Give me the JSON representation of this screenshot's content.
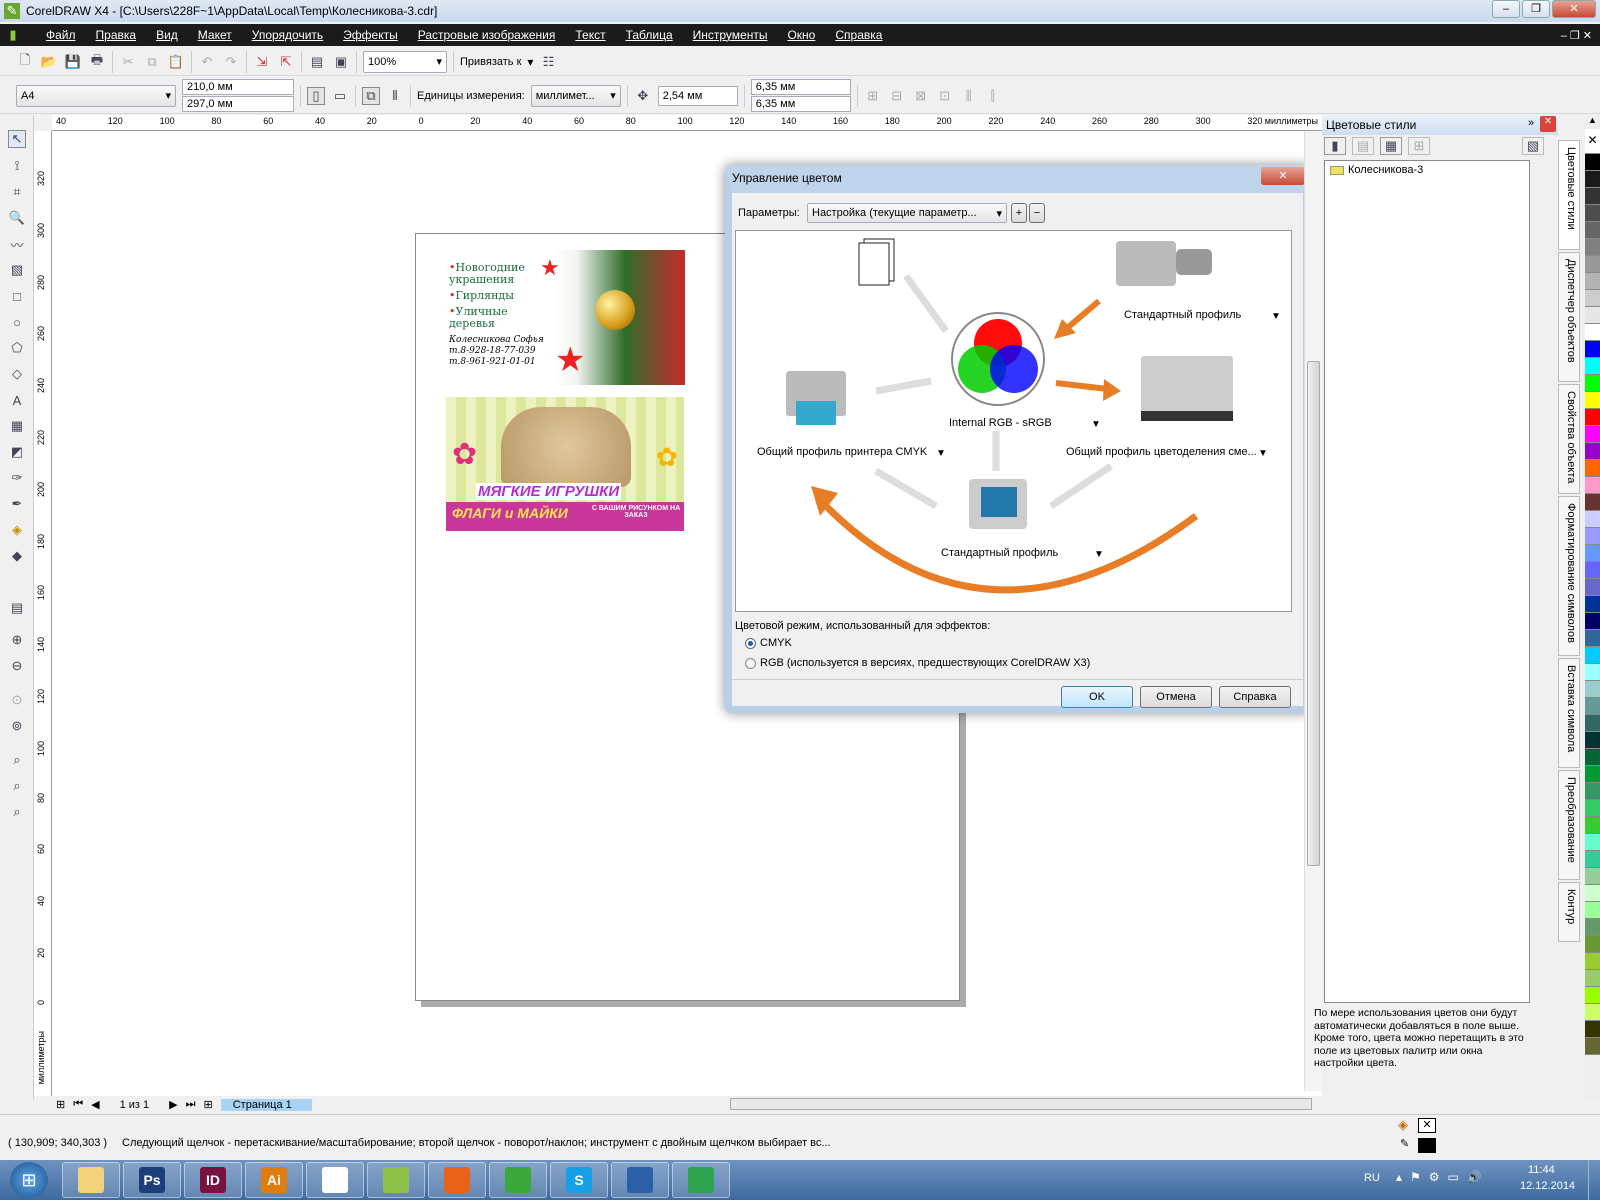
{
  "window": {
    "title": "CorelDRAW X4 - [C:\\Users\\228F~1\\AppData\\Local\\Temp\\Колесникова-3.cdr]"
  },
  "menu": [
    "Файл",
    "Правка",
    "Вид",
    "Макет",
    "Упорядочить",
    "Эффекты",
    "Растровые изображения",
    "Текст",
    "Таблица",
    "Инструменты",
    "Окно",
    "Справка"
  ],
  "toolbar": {
    "zoom": "100%",
    "snap_label": "Привязать к"
  },
  "propbar": {
    "page_size": "A4",
    "width": "210,0 мм",
    "height": "297,0 мм",
    "units_label": "Единицы измерения:",
    "units": "миллимет...",
    "nudge": "2,54 мм",
    "dup_x": "6,35 мм",
    "dup_y": "6,35 мм"
  },
  "ruler": {
    "top_ticks": [
      "40",
      "120",
      "100",
      "80",
      "60",
      "40",
      "20",
      "0",
      "20",
      "40",
      "60",
      "80",
      "100",
      "120",
      "140",
      "160",
      "180",
      "200",
      "220",
      "240",
      "260",
      "280",
      "300",
      "320"
    ],
    "top_unit": "миллиметры",
    "left_ticks": [
      "320",
      "300",
      "280",
      "260",
      "240",
      "220",
      "200",
      "180",
      "160",
      "140",
      "120",
      "100",
      "80",
      "60",
      "40",
      "20",
      "0"
    ],
    "left_unit": "миллиметры"
  },
  "cards": {
    "card1": {
      "items": [
        "Новогодние украшения",
        "Гирлянды",
        "Уличные деревья"
      ],
      "name": "Колесникова Софья",
      "phones": [
        "т.8-928-18-77-039",
        "т.8-961-921-01-01"
      ]
    },
    "card2": {
      "title": "МЯГКИЕ ИГРУШКИ",
      "subtitle": "ФЛАГИ и МАЙКИ",
      "note": "С ВАШИМ РИСУНКОМ НА ЗАКАЗ"
    }
  },
  "dialog": {
    "title": "Управление цветом",
    "params_label": "Параметры:",
    "params_value": "Настройка (текущие параметр...",
    "scanner_profile": "Стандартный профиль",
    "internal": "Internal RGB - sRGB",
    "printer_profile": "Общий профиль принтера CMYK",
    "separation_profile": "Общий профиль цветоделения сме...",
    "monitor_profile": "Стандартный профиль",
    "mode_label": "Цветовой режим, использованный для эффектов:",
    "mode_options": [
      "CMYK",
      "RGB (используется в версиях, предшествующих CorelDRAW X3)"
    ],
    "mode_selected": "CMYK",
    "ok": "OK",
    "cancel": "Отмена",
    "help": "Справка"
  },
  "docker": {
    "title": "Цветовые стили",
    "item": "Колесникова-3",
    "hint": "По мере использования цветов они будут автоматически добавляться в поле выше. Кроме того, цвета можно перетащить в это поле из цветовых палитр или окна настройки цвета."
  },
  "docker_tabs": [
    "Цветовые стили",
    "Диспетчер объектов",
    "Свойства объекта",
    "Форматирование символов",
    "Вставка символа",
    "Преобразование",
    "Контур"
  ],
  "pagenav": {
    "count": "1 из 1",
    "tab": "Страница 1"
  },
  "status": {
    "coords": "( 130,909; 340,303 )",
    "message": "Следующий щелчок - перетаскивание/масштабирование; второй щелчок - поворот/наклон; инструмент с двойным щелчком выбирает вс..."
  },
  "taskbar": {
    "lang": "RU",
    "time": "11:44",
    "date": "12.12.2014",
    "apps": [
      {
        "label": "",
        "color": "#f3d37a"
      },
      {
        "label": "Ps",
        "color": "#1c3f7a"
      },
      {
        "label": "ID",
        "color": "#7a1240"
      },
      {
        "label": "Ai",
        "color": "#e07d10"
      },
      {
        "label": "",
        "color": "#ffffff"
      },
      {
        "label": "",
        "color": "#8fc04a"
      },
      {
        "label": "",
        "color": "#e8621a"
      },
      {
        "label": "",
        "color": "#3aa83a"
      },
      {
        "label": "S",
        "color": "#16a0e8"
      },
      {
        "label": "",
        "color": "#2b5fa8"
      },
      {
        "label": "",
        "color": "#2ea44f"
      }
    ]
  },
  "palette": [
    "#000000",
    "#1a1a1a",
    "#333333",
    "#4d4d4d",
    "#666666",
    "#808080",
    "#999999",
    "#b3b3b3",
    "#cccccc",
    "#e6e6e6",
    "#ffffff",
    "#0000ff",
    "#00ffff",
    "#00ff00",
    "#ffff00",
    "#ff0000",
    "#ff00ff",
    "#9900cc",
    "#ff6600",
    "#ff99cc",
    "#663333",
    "#ccccff",
    "#9999ff",
    "#6699ff",
    "#6666ff",
    "#6666cc",
    "#003399",
    "#000066",
    "#336699",
    "#00ccff",
    "#99ffff",
    "#99cccc",
    "#669999",
    "#336666",
    "#003333",
    "#006633",
    "#009933",
    "#339966",
    "#33cc66",
    "#33cc33",
    "#66ffcc",
    "#33cc99",
    "#99cc99",
    "#ccffcc",
    "#99ff99",
    "#669966",
    "#669933",
    "#99cc33",
    "#99cc66",
    "#99ff00",
    "#ccff66",
    "#333300",
    "#666633"
  ]
}
